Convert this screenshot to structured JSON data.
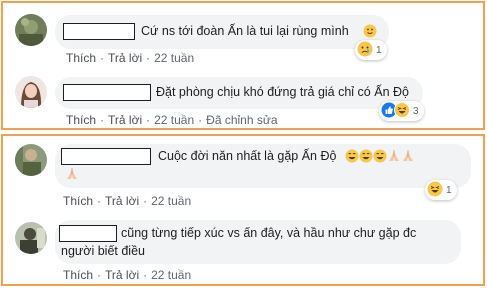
{
  "comments": [
    {
      "text": "Cứ ns tới đoàn Ấn là tui lại rùng mình",
      "actions": {
        "like": "Thích",
        "reply": "Trả lời",
        "time": "22 tuần"
      },
      "reaction_count": "1"
    },
    {
      "text": "Đặt phòng chịu khó đứng trả giá chỉ có Ấn Độ",
      "actions": {
        "like": "Thích",
        "reply": "Trả lời",
        "time": "22 tuần",
        "edited": "Đã chỉnh sửa"
      },
      "reaction_count": "3"
    },
    {
      "text": "Cuộc đời năn nhất là gặp Ấn Độ",
      "actions": {
        "like": "Thích",
        "reply": "Trả lời",
        "time": "22 tuần"
      },
      "reaction_count": "1"
    },
    {
      "text_line1": "cũng từng tiếp xúc vs ấn đây, và hầu như chư gặp đc",
      "text_line2": "người biết điều",
      "actions": {
        "like": "Thích",
        "reply": "Trả lời",
        "time": "22 tuần"
      }
    }
  ],
  "separator": "·",
  "colors": {
    "frame": "#f0a050",
    "bubble": "#f2f3f5",
    "meta": "#606770",
    "like_blue": "#1877f2",
    "emoji_yellow": "#f7c74a"
  }
}
